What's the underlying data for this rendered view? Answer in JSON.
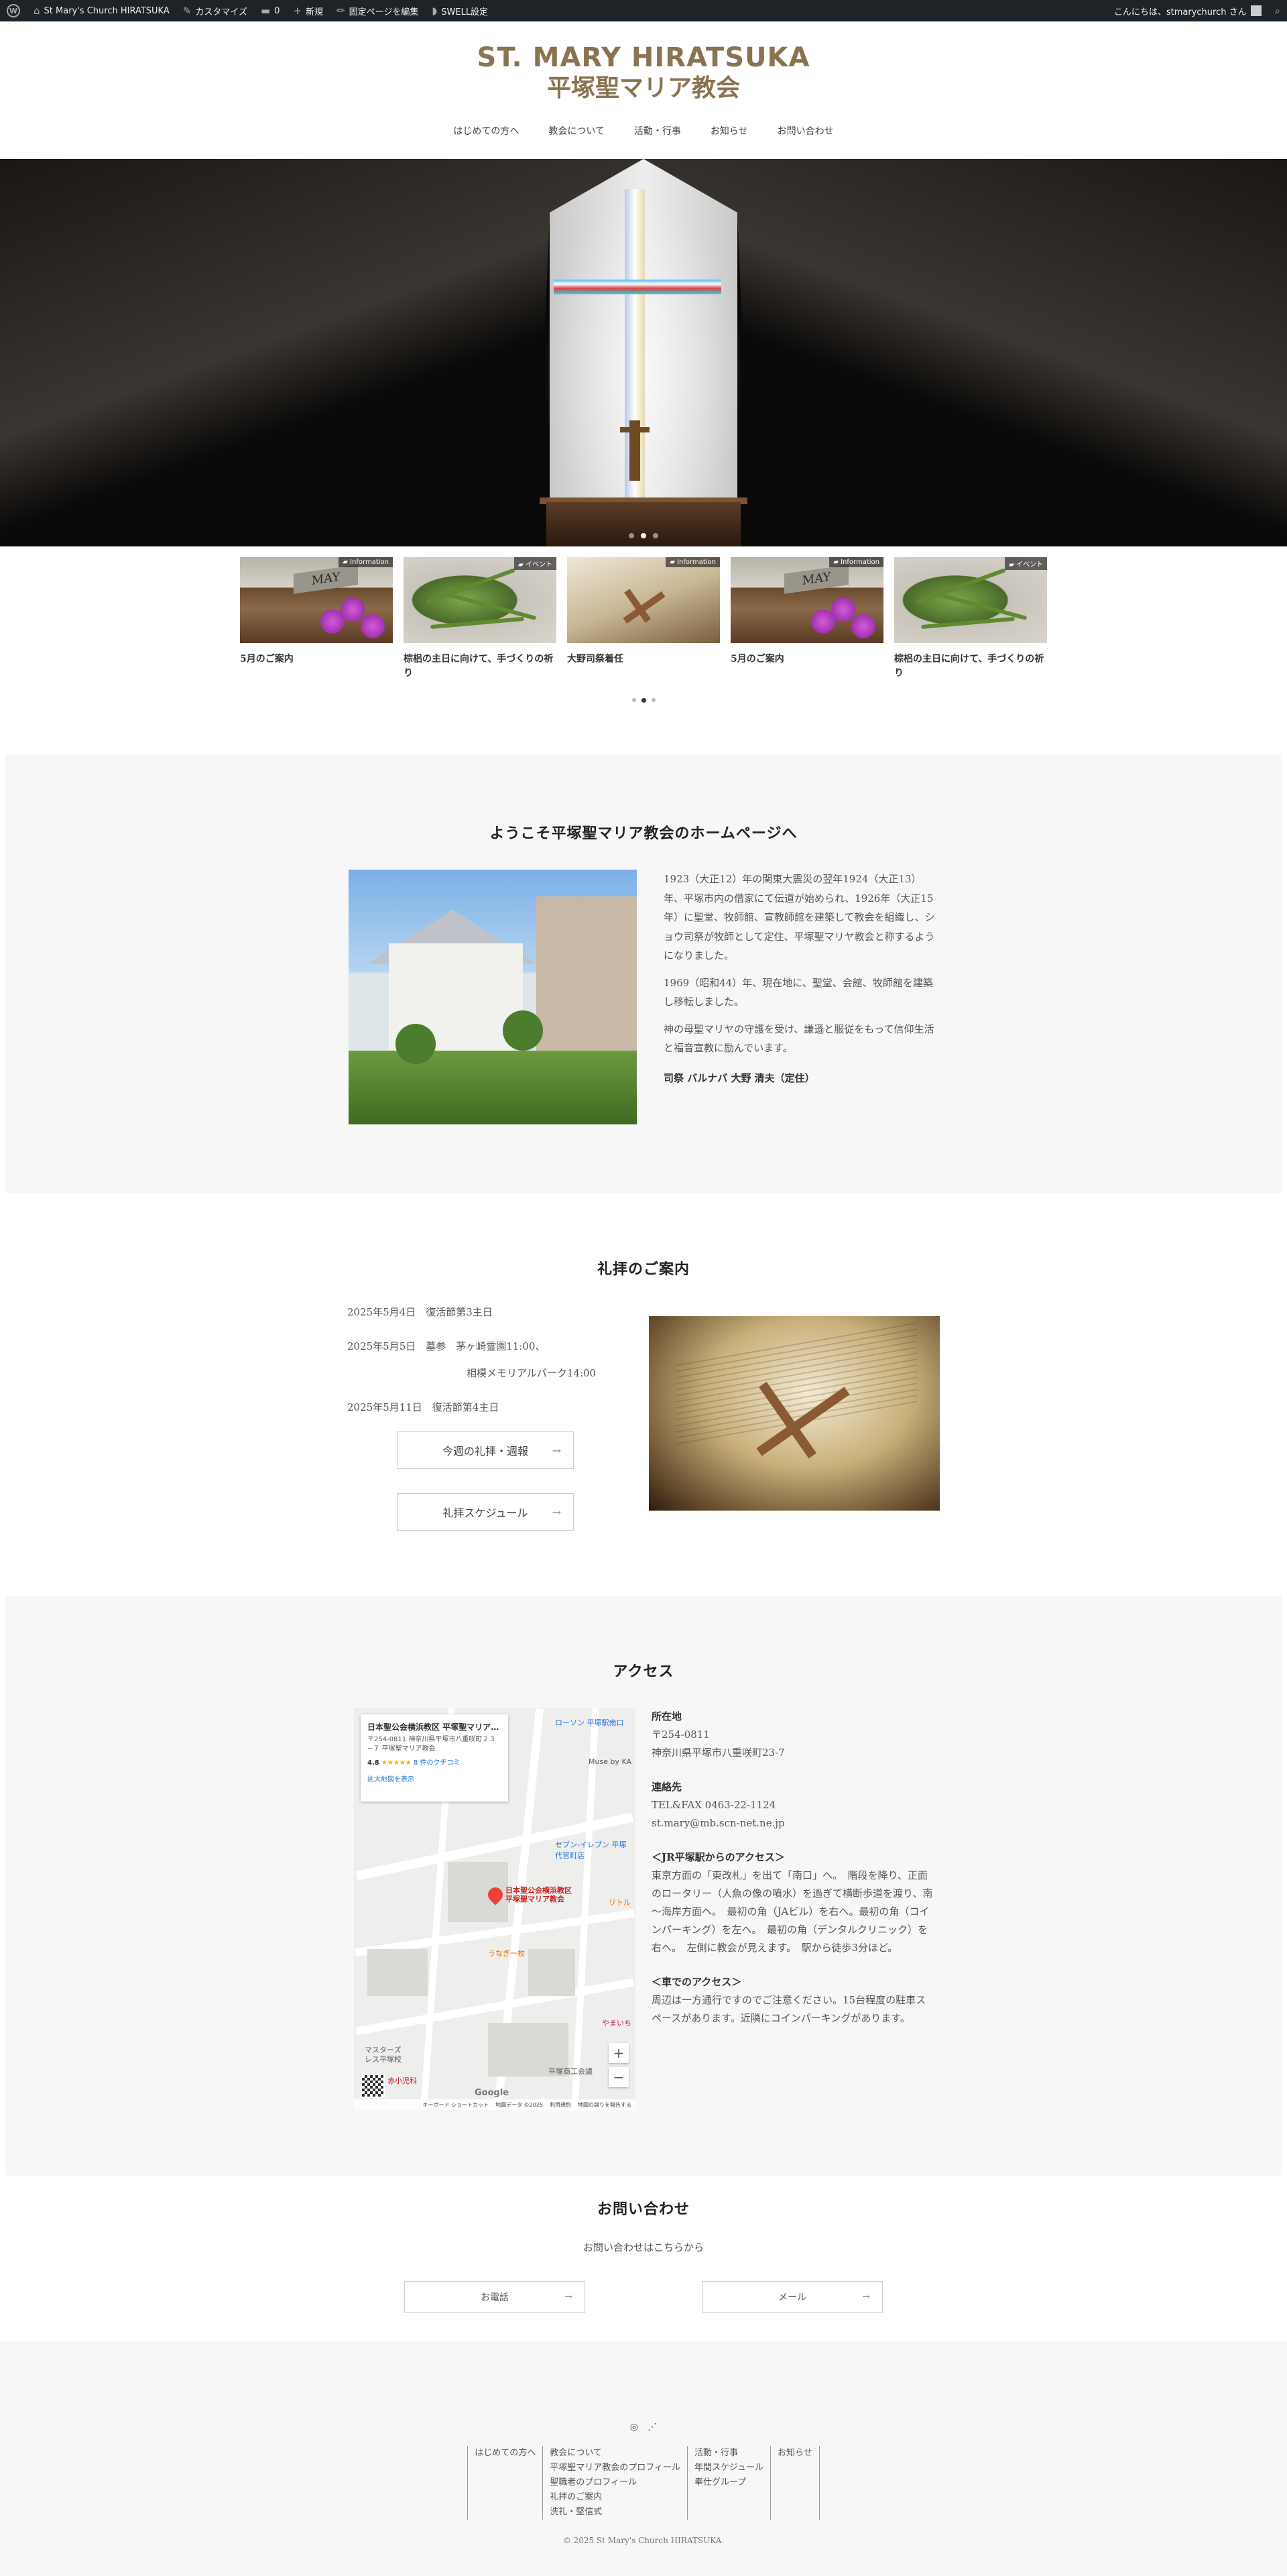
{
  "adminbar": {
    "site_name": "St Mary's Church HIRATSUKA",
    "customize": "カスタマイズ",
    "comments": "0",
    "new": "新規",
    "edit_page": "固定ページを編集",
    "swell": "SWELL設定",
    "greeting": "こんにちは、stmarychurch さん"
  },
  "logo": {
    "en": "ST. MARY HIRATSUKA",
    "ja": "平塚聖マリア教会"
  },
  "nav": [
    "はじめての方へ",
    "教会について",
    "活動・行事",
    "お知らせ",
    "お問い合わせ"
  ],
  "posts": [
    {
      "title": "5月のご案内",
      "category": "Information",
      "thumb": "may",
      "may_text": "MAY"
    },
    {
      "title": "棕梠の主日に向けて、手づくりの祈り",
      "category": "イベント",
      "thumb": "plant"
    },
    {
      "title": "大野司祭着任",
      "category": "Information",
      "thumb": "bible"
    },
    {
      "title": "5月のご案内",
      "category": "Information",
      "thumb": "may",
      "may_text": "MAY"
    },
    {
      "title": "棕梠の主日に向けて、手づくりの祈り",
      "category": "イベント",
      "thumb": "plant"
    }
  ],
  "welcome": {
    "title": "ようこそ平塚聖マリア教会のホームページへ",
    "p1": "1923（大正12）年の関東大震災の翌年1924（大正13）年、平塚市内の借家にて伝道が始められ、1926年（大正15年）に聖堂、牧師館、宣教師館を建築して教会を組織し、ショウ司祭が牧師として定住、平塚聖マリヤ教会と称するようになりました。",
    "p2": "1969（昭和44）年、現在地に、聖堂、会館、牧師館を建築し移転しました。",
    "p3": "神の母聖マリヤの守護を受け、謙遜と服従をもって信仰生活と福音宣教に励んでいます。",
    "signature": "司祭 バルナバ 大野 清夫（定住）"
  },
  "worship": {
    "title": "礼拝のご案内",
    "schedule": [
      "2025年5月4日　復活節第3主日",
      "2025年5月5日　墓参　茅ヶ崎霊園11:00、",
      "相模メモリアルパーク14:00",
      "2025年5月11日　復活節第4主日"
    ],
    "btn1": "今週の礼拝・週報",
    "btn2": "礼拝スケジュール"
  },
  "access": {
    "title": "アクセス",
    "map": {
      "place_name": "日本聖公会横浜教区 平塚聖マリア教会",
      "place_addr": "〒254-0811 神奈川県平塚市八重咲町２３−７ 平塚聖マリア教会",
      "rating": "4.8",
      "stars": "★★★★★",
      "reviews": "8 件のクチコミ",
      "larger_map": "拡大地図を表示",
      "pin_label_1": "日本聖公会横浜教区",
      "pin_label_2": "平塚聖マリア教会",
      "poi": [
        "ローソン 平塚駅南口",
        "Muse by KA",
        "セブン-イレブン 平塚代官町店",
        "うなぎ一枚",
        "マスターズ",
        "レス平塚校",
        "赤小児科",
        "やまいち",
        "平塚商工会議",
        "リトル"
      ],
      "footer": [
        "キーボード ショートカット",
        "地図データ ©2025",
        "利用規約",
        "地図の誤りを報告する"
      ],
      "google": "Google"
    },
    "address_label": "所在地",
    "postal": "〒254-0811",
    "address": "神奈川県平塚市八重咲町23-7",
    "contact_label": "連絡先",
    "tel": "TEL&FAX 0463-22-1124",
    "email": "st.mary@mb.scn-net.ne.jp",
    "jr_label": "＜JR平塚駅からのアクセス＞",
    "jr_text": "東京方面の「東改札」を出て「南口」へ。　階段を降り、正面のロータリー（人魚の像の噴水）を過ぎて横断歩道を渡り、南～海岸方面へ。　最初の角（JAビル）を右へ。最初の角（コインパーキング）を左へ。　最初の角（デンタルクリニック）を右へ。　左側に教会が見えます。　駅から徒歩3分ほど。",
    "car_label": "＜車でのアクセス＞",
    "car_text": "周辺は一方通行ですのでご注意ください。15台程度の駐車スペースがあります。近隣にコインパーキングがあります。"
  },
  "contact": {
    "title": "お問い合わせ",
    "subtitle": "お問い合わせはこちらから",
    "phone_btn": "お電話",
    "mail_btn": "メール"
  },
  "footer": {
    "cols": [
      [
        "はじめての方へ"
      ],
      [
        "教会について",
        "平塚聖マリア教会のプロフィール",
        "聖職者のプロフィール",
        "礼拝のご案内",
        "洗礼・堅信式"
      ],
      [
        "活動・行事",
        "年間スケジュール",
        "奉仕グループ"
      ],
      [
        "お知らせ"
      ]
    ],
    "copyright": "© 2025 St Mary's Church HIRATSUKA."
  }
}
